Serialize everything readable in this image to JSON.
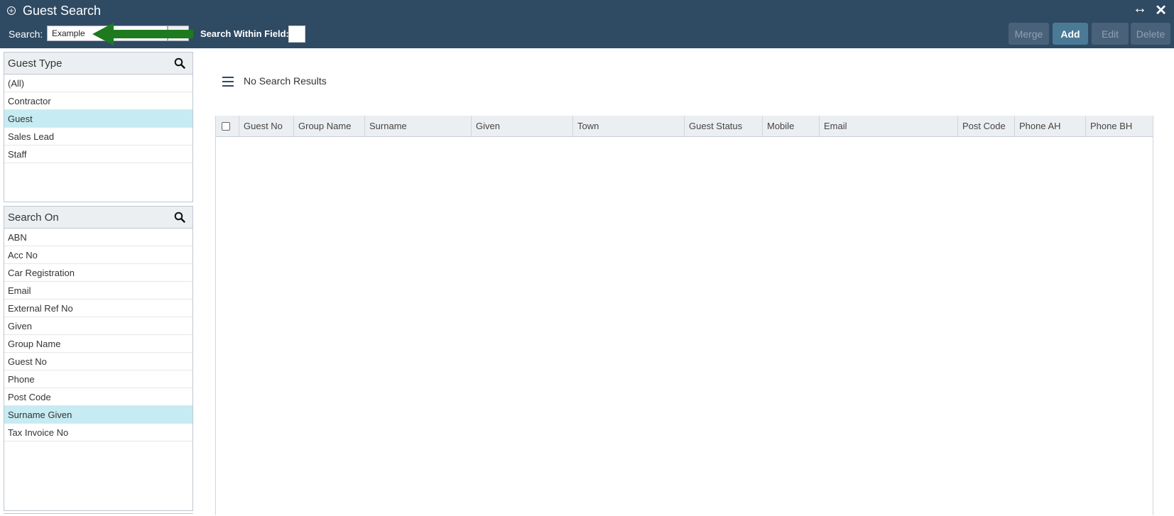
{
  "header": {
    "title": "Guest Search",
    "search_label": "Search:",
    "search_value": "Example",
    "search_within_label": "Search Within Field:",
    "buttons": {
      "merge": "Merge",
      "add": "Add",
      "edit": "Edit",
      "delete": "Delete"
    }
  },
  "guest_type": {
    "title": "Guest Type",
    "items": [
      "(All)",
      "Contractor",
      "Guest",
      "Sales Lead",
      "Staff"
    ],
    "selected": "Guest"
  },
  "search_on": {
    "title": "Search On",
    "items": [
      "ABN",
      "Acc No",
      "Car Registration",
      "Email",
      "External Ref No",
      "Given",
      "Group Name",
      "Guest No",
      "Phone",
      "Post Code",
      "Surname Given",
      "Tax Invoice No"
    ],
    "selected": "Surname Given"
  },
  "results": {
    "status": "No Search Results",
    "columns": [
      "Guest No",
      "Group Name",
      "Surname",
      "Given",
      "Town",
      "Guest Status",
      "Mobile",
      "Email",
      "Post Code",
      "Phone AH",
      "Phone BH"
    ]
  },
  "colors": {
    "header_bg": "#2f4a63",
    "selected_row": "#c6ebf2",
    "annotation_arrow": "#1e7a1e"
  }
}
